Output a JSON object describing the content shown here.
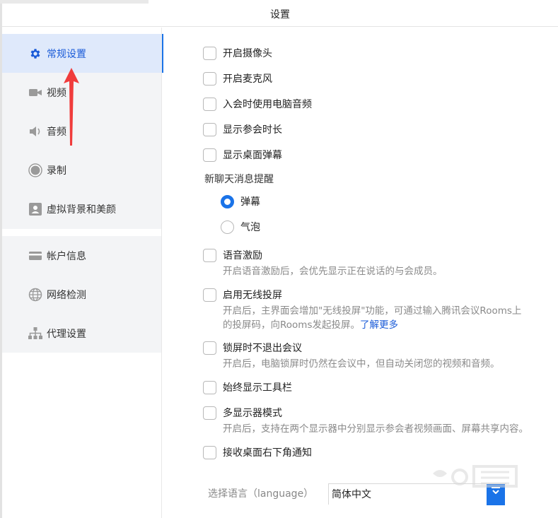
{
  "window": {
    "title": "设置"
  },
  "sidebar": {
    "items": [
      {
        "label": "常规设置",
        "icon": "gear-icon",
        "active": true
      },
      {
        "label": "视频",
        "icon": "video-camera-icon"
      },
      {
        "label": "音频",
        "icon": "speaker-icon"
      },
      {
        "label": "录制",
        "icon": "record-icon"
      },
      {
        "label": "虚拟背景和美颜",
        "icon": "portrait-icon"
      },
      {
        "label": "帐户信息",
        "icon": "card-icon"
      },
      {
        "label": "网络检测",
        "icon": "globe-icon"
      },
      {
        "label": "代理设置",
        "icon": "network-tree-icon"
      }
    ]
  },
  "settings": {
    "options": [
      {
        "label": "开启摄像头",
        "checked": false
      },
      {
        "label": "开启麦克风",
        "checked": false
      },
      {
        "label": "入会时使用电脑音频",
        "checked": false
      },
      {
        "label": "显示参会时长",
        "checked": false
      },
      {
        "label": "显示桌面弹幕",
        "checked": false
      }
    ],
    "chat_section_title": "新聊天消息提醒",
    "chat_radio": [
      {
        "label": "弹幕",
        "selected": true
      },
      {
        "label": "气泡",
        "selected": false
      }
    ],
    "voice_excite": {
      "label": "语音激励",
      "checked": false,
      "desc": "开启语音激励后，会优先显示正在说话的与会成员。"
    },
    "wireless": {
      "label": "启用无线投屏",
      "checked": false,
      "desc_line1": "开启后，主界面会增加\"无线投屏\"功能，可通过输入腾讯会议Rooms上",
      "desc_line2": "的投屏码，向Rooms发起投屏。",
      "link": "了解更多"
    },
    "lock_screen": {
      "label": "锁屏时不退出会议",
      "checked": false,
      "desc": "开启后，电脑锁屏时仍然在会议中，但自动关闭您的视频和音频。"
    },
    "toolbar": {
      "label": "始终显示工具栏",
      "checked": false
    },
    "multi_display": {
      "label": "多显示器模式",
      "checked": false,
      "desc": "开启后，支持在两个显示器中分别显示参会者视频画面、屏幕共享内容。"
    },
    "notify": {
      "label": "接收桌面右下角通知",
      "checked": false
    },
    "language": {
      "label": "选择语言（language）",
      "value": "简体中文"
    }
  },
  "colors": {
    "accent": "#1a73e8",
    "active_bg": "#dfe9fb",
    "annotation_arrow": "#f03c3c"
  }
}
